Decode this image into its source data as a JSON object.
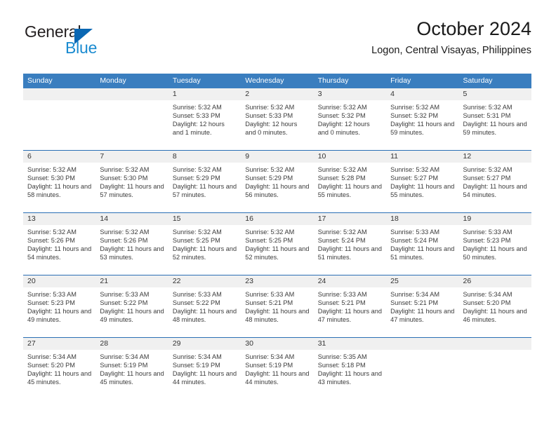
{
  "brand": {
    "name_top": "General",
    "name_bottom": "Blue",
    "triangle_color": "#0a67b3",
    "blue_text_color": "#1b8bd0"
  },
  "header": {
    "title": "October 2024",
    "subtitle": "Logon, Central Visayas, Philippines"
  },
  "theme": {
    "header_blue": "#3a7ebf",
    "row_divider_blue": "#2a6fb5",
    "day_band_gray": "#f0f0f0",
    "text_dark": "#333333"
  },
  "weekdays": [
    "Sunday",
    "Monday",
    "Tuesday",
    "Wednesday",
    "Thursday",
    "Friday",
    "Saturday"
  ],
  "weeks": [
    [
      {
        "day": "",
        "sunrise": "",
        "sunset": "",
        "daylight": "",
        "empty": true
      },
      {
        "day": "",
        "sunrise": "",
        "sunset": "",
        "daylight": "",
        "empty": true
      },
      {
        "day": "1",
        "sunrise": "Sunrise: 5:32 AM",
        "sunset": "Sunset: 5:33 PM",
        "daylight": "Daylight: 12 hours and 1 minute."
      },
      {
        "day": "2",
        "sunrise": "Sunrise: 5:32 AM",
        "sunset": "Sunset: 5:33 PM",
        "daylight": "Daylight: 12 hours and 0 minutes."
      },
      {
        "day": "3",
        "sunrise": "Sunrise: 5:32 AM",
        "sunset": "Sunset: 5:32 PM",
        "daylight": "Daylight: 12 hours and 0 minutes."
      },
      {
        "day": "4",
        "sunrise": "Sunrise: 5:32 AM",
        "sunset": "Sunset: 5:32 PM",
        "daylight": "Daylight: 11 hours and 59 minutes."
      },
      {
        "day": "5",
        "sunrise": "Sunrise: 5:32 AM",
        "sunset": "Sunset: 5:31 PM",
        "daylight": "Daylight: 11 hours and 59 minutes."
      }
    ],
    [
      {
        "day": "6",
        "sunrise": "Sunrise: 5:32 AM",
        "sunset": "Sunset: 5:30 PM",
        "daylight": "Daylight: 11 hours and 58 minutes."
      },
      {
        "day": "7",
        "sunrise": "Sunrise: 5:32 AM",
        "sunset": "Sunset: 5:30 PM",
        "daylight": "Daylight: 11 hours and 57 minutes."
      },
      {
        "day": "8",
        "sunrise": "Sunrise: 5:32 AM",
        "sunset": "Sunset: 5:29 PM",
        "daylight": "Daylight: 11 hours and 57 minutes."
      },
      {
        "day": "9",
        "sunrise": "Sunrise: 5:32 AM",
        "sunset": "Sunset: 5:29 PM",
        "daylight": "Daylight: 11 hours and 56 minutes."
      },
      {
        "day": "10",
        "sunrise": "Sunrise: 5:32 AM",
        "sunset": "Sunset: 5:28 PM",
        "daylight": "Daylight: 11 hours and 55 minutes."
      },
      {
        "day": "11",
        "sunrise": "Sunrise: 5:32 AM",
        "sunset": "Sunset: 5:27 PM",
        "daylight": "Daylight: 11 hours and 55 minutes."
      },
      {
        "day": "12",
        "sunrise": "Sunrise: 5:32 AM",
        "sunset": "Sunset: 5:27 PM",
        "daylight": "Daylight: 11 hours and 54 minutes."
      }
    ],
    [
      {
        "day": "13",
        "sunrise": "Sunrise: 5:32 AM",
        "sunset": "Sunset: 5:26 PM",
        "daylight": "Daylight: 11 hours and 54 minutes."
      },
      {
        "day": "14",
        "sunrise": "Sunrise: 5:32 AM",
        "sunset": "Sunset: 5:26 PM",
        "daylight": "Daylight: 11 hours and 53 minutes."
      },
      {
        "day": "15",
        "sunrise": "Sunrise: 5:32 AM",
        "sunset": "Sunset: 5:25 PM",
        "daylight": "Daylight: 11 hours and 52 minutes."
      },
      {
        "day": "16",
        "sunrise": "Sunrise: 5:32 AM",
        "sunset": "Sunset: 5:25 PM",
        "daylight": "Daylight: 11 hours and 52 minutes."
      },
      {
        "day": "17",
        "sunrise": "Sunrise: 5:32 AM",
        "sunset": "Sunset: 5:24 PM",
        "daylight": "Daylight: 11 hours and 51 minutes."
      },
      {
        "day": "18",
        "sunrise": "Sunrise: 5:33 AM",
        "sunset": "Sunset: 5:24 PM",
        "daylight": "Daylight: 11 hours and 51 minutes."
      },
      {
        "day": "19",
        "sunrise": "Sunrise: 5:33 AM",
        "sunset": "Sunset: 5:23 PM",
        "daylight": "Daylight: 11 hours and 50 minutes."
      }
    ],
    [
      {
        "day": "20",
        "sunrise": "Sunrise: 5:33 AM",
        "sunset": "Sunset: 5:23 PM",
        "daylight": "Daylight: 11 hours and 49 minutes."
      },
      {
        "day": "21",
        "sunrise": "Sunrise: 5:33 AM",
        "sunset": "Sunset: 5:22 PM",
        "daylight": "Daylight: 11 hours and 49 minutes."
      },
      {
        "day": "22",
        "sunrise": "Sunrise: 5:33 AM",
        "sunset": "Sunset: 5:22 PM",
        "daylight": "Daylight: 11 hours and 48 minutes."
      },
      {
        "day": "23",
        "sunrise": "Sunrise: 5:33 AM",
        "sunset": "Sunset: 5:21 PM",
        "daylight": "Daylight: 11 hours and 48 minutes."
      },
      {
        "day": "24",
        "sunrise": "Sunrise: 5:33 AM",
        "sunset": "Sunset: 5:21 PM",
        "daylight": "Daylight: 11 hours and 47 minutes."
      },
      {
        "day": "25",
        "sunrise": "Sunrise: 5:34 AM",
        "sunset": "Sunset: 5:21 PM",
        "daylight": "Daylight: 11 hours and 47 minutes."
      },
      {
        "day": "26",
        "sunrise": "Sunrise: 5:34 AM",
        "sunset": "Sunset: 5:20 PM",
        "daylight": "Daylight: 11 hours and 46 minutes."
      }
    ],
    [
      {
        "day": "27",
        "sunrise": "Sunrise: 5:34 AM",
        "sunset": "Sunset: 5:20 PM",
        "daylight": "Daylight: 11 hours and 45 minutes."
      },
      {
        "day": "28",
        "sunrise": "Sunrise: 5:34 AM",
        "sunset": "Sunset: 5:19 PM",
        "daylight": "Daylight: 11 hours and 45 minutes."
      },
      {
        "day": "29",
        "sunrise": "Sunrise: 5:34 AM",
        "sunset": "Sunset: 5:19 PM",
        "daylight": "Daylight: 11 hours and 44 minutes."
      },
      {
        "day": "30",
        "sunrise": "Sunrise: 5:34 AM",
        "sunset": "Sunset: 5:19 PM",
        "daylight": "Daylight: 11 hours and 44 minutes."
      },
      {
        "day": "31",
        "sunrise": "Sunrise: 5:35 AM",
        "sunset": "Sunset: 5:18 PM",
        "daylight": "Daylight: 11 hours and 43 minutes."
      },
      {
        "day": "",
        "sunrise": "",
        "sunset": "",
        "daylight": "",
        "empty": true
      },
      {
        "day": "",
        "sunrise": "",
        "sunset": "",
        "daylight": "",
        "empty": true
      }
    ]
  ]
}
